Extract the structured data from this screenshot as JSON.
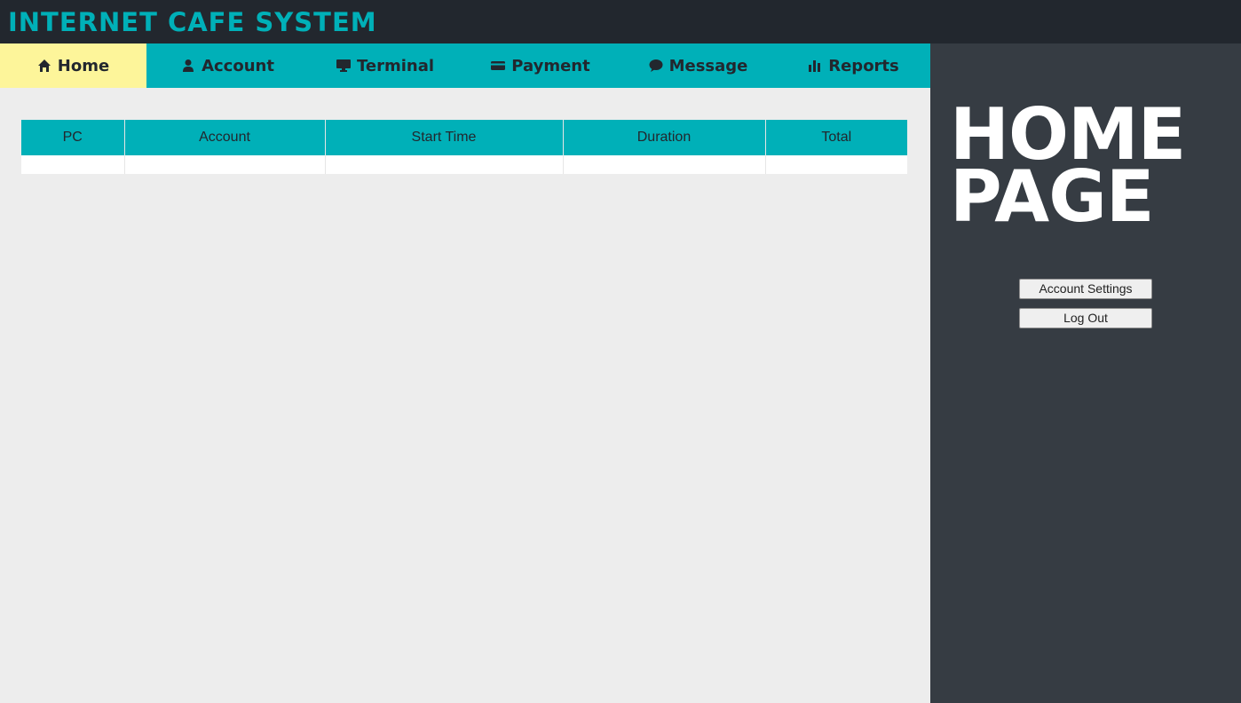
{
  "app": {
    "title": "INTERNET CAFE SYSTEM"
  },
  "nav": {
    "items": [
      {
        "label": "Home",
        "icon": "home-icon",
        "active": true
      },
      {
        "label": "Account",
        "icon": "user-icon",
        "active": false
      },
      {
        "label": "Terminal",
        "icon": "monitor-icon",
        "active": false
      },
      {
        "label": "Payment",
        "icon": "credit-card-icon",
        "active": false
      },
      {
        "label": "Message",
        "icon": "chat-icon",
        "active": false
      },
      {
        "label": "Reports",
        "icon": "bar-chart-icon",
        "active": false
      }
    ]
  },
  "table": {
    "columns": [
      "PC",
      "Account",
      "Start Time",
      "Duration",
      "Total"
    ],
    "rows": [
      [
        "",
        "",
        "",
        "",
        ""
      ]
    ]
  },
  "side": {
    "heading_line1": "HOME",
    "heading_line2": "PAGE",
    "account_settings_label": "Account Settings",
    "logout_label": "Log Out"
  },
  "colors": {
    "accent": "#00b0b8",
    "active_tab": "#fdf59a",
    "topbar": "#22272e",
    "sidebar": "#363c43",
    "content_bg": "#ededed"
  }
}
